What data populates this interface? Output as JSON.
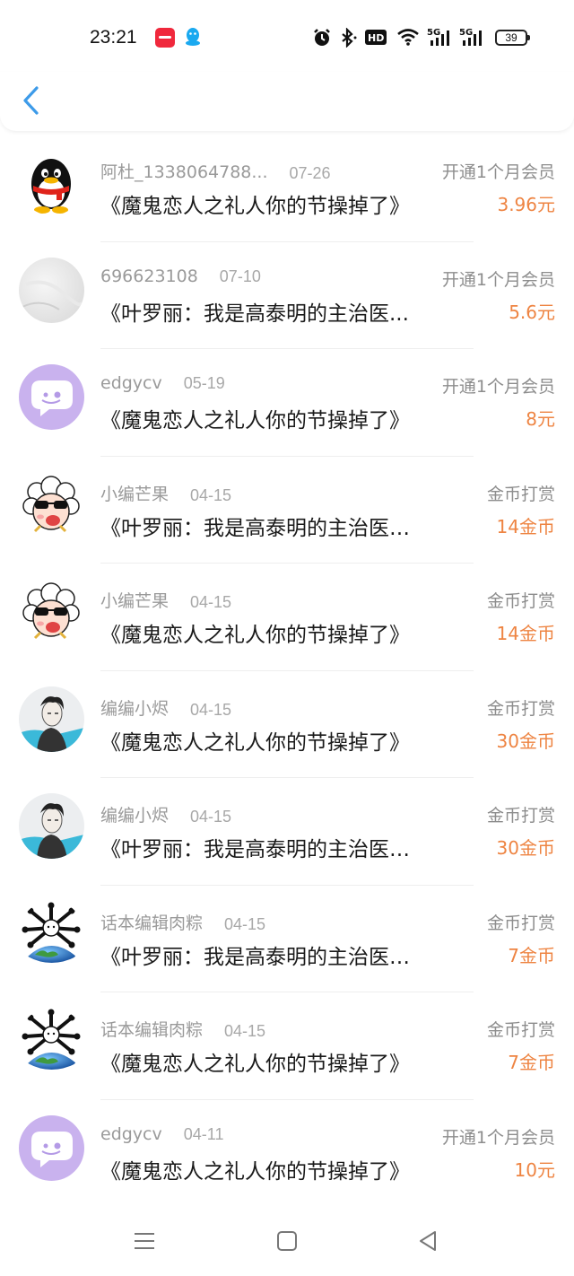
{
  "status_bar": {
    "time": "23:21",
    "battery": "39",
    "icons": [
      "xiaohongshu-app-icon",
      "qq-app-icon",
      "alarm-icon",
      "bluetooth-icon",
      "hd-icon",
      "wifi-icon",
      "5g-signal-icon",
      "5g-signal-icon"
    ]
  },
  "header": {
    "back_icon": "chevron-left-icon"
  },
  "colors": {
    "accent": "#3d9be9",
    "amount": "#ee8442",
    "secondary_text": "#9a9a9a"
  },
  "records": [
    {
      "name": "阿杜_1338064788...",
      "date": "07-26",
      "title": "《魔鬼恋人之礼人你的节操掉了》",
      "action": "开通1个月会员",
      "amount": "3.96元",
      "avatar": "qq-penguin"
    },
    {
      "name": "696623108",
      "date": "07-10",
      "title": "《叶罗丽：我是高泰明的主治医...",
      "action": "开通1个月会员",
      "amount": "5.6元",
      "avatar": "marble"
    },
    {
      "name": "edgycv",
      "date": "05-19",
      "title": "《魔鬼恋人之礼人你的节操掉了》",
      "action": "开通1个月会员",
      "amount": "8元",
      "avatar": "purple-chat"
    },
    {
      "name": "小编芒果",
      "date": "04-15",
      "title": "《叶罗丽：我是高泰明的主治医生》",
      "action": "金币打赏",
      "amount": "14金币",
      "avatar": "sheep-sunglasses"
    },
    {
      "name": "小编芒果",
      "date": "04-15",
      "title": "《魔鬼恋人之礼人你的节操掉了》",
      "action": "金币打赏",
      "amount": "14金币",
      "avatar": "sheep-sunglasses"
    },
    {
      "name": "编编小烬",
      "date": "04-15",
      "title": "《魔鬼恋人之礼人你的节操掉了》",
      "action": "金币打赏",
      "amount": "30金币",
      "avatar": "anime-man"
    },
    {
      "name": "编编小烬",
      "date": "04-15",
      "title": "《叶罗丽：我是高泰明的主治医生》",
      "action": "金币打赏",
      "amount": "30金币",
      "avatar": "anime-man"
    },
    {
      "name": "话本编辑肉粽",
      "date": "04-15",
      "title": "《叶罗丽：我是高泰明的主治医生》",
      "action": "金币打赏",
      "amount": "7金币",
      "avatar": "earth-bones"
    },
    {
      "name": "话本编辑肉粽",
      "date": "04-15",
      "title": "《魔鬼恋人之礼人你的节操掉了》",
      "action": "金币打赏",
      "amount": "7金币",
      "avatar": "earth-bones"
    },
    {
      "name": "edgycv",
      "date": "04-11",
      "title": "《魔鬼恋人之礼人你的节操掉了》",
      "action": "开通1个月会员",
      "amount": "10元",
      "avatar": "purple-chat"
    }
  ],
  "nav": {
    "menu_icon": "menu-icon",
    "home_icon": "square-home-icon",
    "back_icon": "triangle-back-icon"
  }
}
